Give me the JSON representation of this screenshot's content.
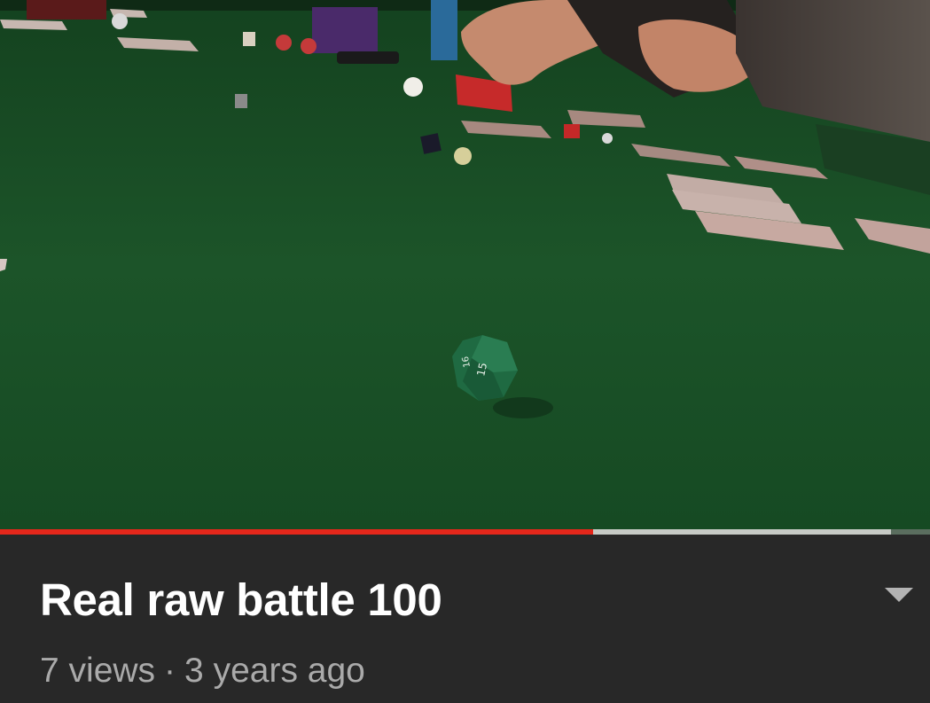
{
  "video": {
    "title": "Real raw battle 100",
    "views": "7 views",
    "separator": "·",
    "age": "3 years ago",
    "progress_played_percent": 63.8,
    "progress_buffered_percent": 95.8
  },
  "icons": {
    "expand": "chevron-down-icon"
  },
  "colors": {
    "progress_played": "#e5271b",
    "progress_buffered": "#c7cbc6",
    "background": "#282828",
    "title": "#ffffff",
    "meta": "#aaaaaa"
  }
}
